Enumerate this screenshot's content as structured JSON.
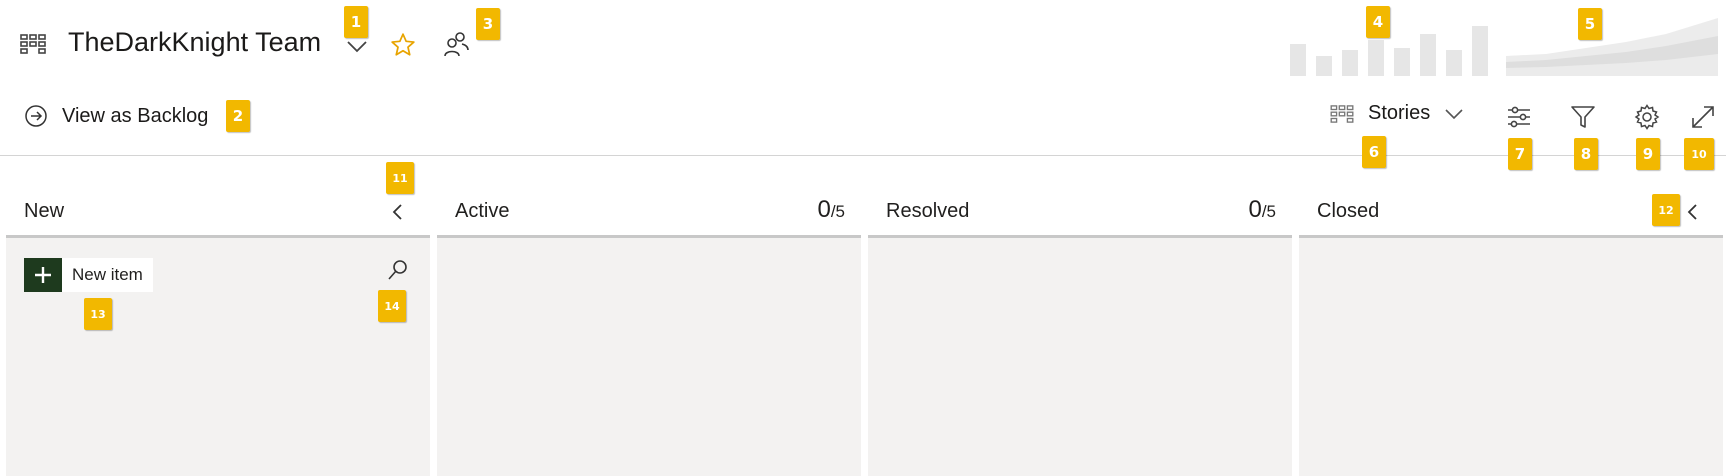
{
  "header": {
    "team_name": "TheDarkKnight Team",
    "icons": {
      "board": "board-grid-icon",
      "dropdown": "chevron-down-icon",
      "favorite": "star-outline-icon",
      "members": "team-members-icon"
    },
    "velocity_chart_icon": "velocity-chart-icon",
    "cfd_chart_icon": "cumulative-flow-chart-icon"
  },
  "toolbar": {
    "view_as_backlog_label": "View as Backlog",
    "backlog_level_label": "Stories",
    "icons": [
      "board-settings-sliders-icon",
      "filter-icon",
      "gear-icon",
      "fullscreen-expand-icon"
    ]
  },
  "columns": [
    {
      "title": "New",
      "count": "",
      "limit": ""
    },
    {
      "title": "Active",
      "count": "0",
      "limit": "/5"
    },
    {
      "title": "Resolved",
      "count": "0",
      "limit": "/5"
    },
    {
      "title": "Closed",
      "count": "",
      "limit": ""
    }
  ],
  "new_column": {
    "new_item_label": "New item"
  },
  "callouts": [
    "1",
    "2",
    "3",
    "4",
    "5",
    "6",
    "7",
    "8",
    "9",
    "10",
    "11",
    "12",
    "13",
    "14"
  ],
  "colors": {
    "callout": "#f2b800",
    "star": "#e8a400",
    "new_item_button": "#1e3a1e",
    "column_body": "#f3f2f1",
    "chart_bar": "#e6e6e6"
  }
}
